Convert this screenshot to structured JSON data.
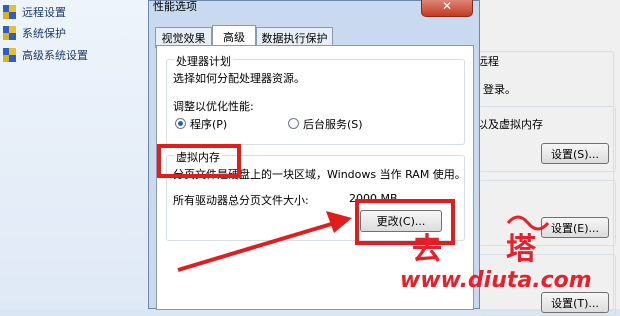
{
  "sidebar": {
    "items": [
      {
        "label": "远程设置",
        "icon": "shield-icon"
      },
      {
        "label": "系统保护",
        "icon": "shield-icon"
      },
      {
        "label": "高级系统设置",
        "icon": "shield-icon"
      }
    ]
  },
  "dialog": {
    "title": "性能选项",
    "close_label": "✕",
    "tabs": [
      {
        "label": "视觉效果"
      },
      {
        "label": "高级"
      },
      {
        "label": "数据执行保护"
      }
    ],
    "processor": {
      "group_title": "处理器计划",
      "description": "选择如何分配处理器资源。",
      "adjust_label": "调整以优化性能:",
      "option_programs": "程序(P)",
      "option_background": "后台服务(S)"
    },
    "virtual_memory": {
      "group_title": "虚拟内存",
      "description": "分页文件是硬盘上的一块区域，Windows 当作 RAM 使用。",
      "total_label": "所有驱动器总分页文件大小:",
      "total_value": "2000 MB",
      "change_button": "更改(C)..."
    }
  },
  "background_dialog": {
    "remote_tab": "远程",
    "login_text": "登录。",
    "virtual_memory_text": "以及虚拟内存",
    "settings_s": "设置(S)...",
    "settings_e": "设置(E)...",
    "settings_t": "设置(T)..."
  },
  "watermark": {
    "brand": "去塔",
    "url": "www.diuta.com"
  },
  "colors": {
    "highlight": "#e21d1d",
    "watermark": "#e8202a"
  }
}
